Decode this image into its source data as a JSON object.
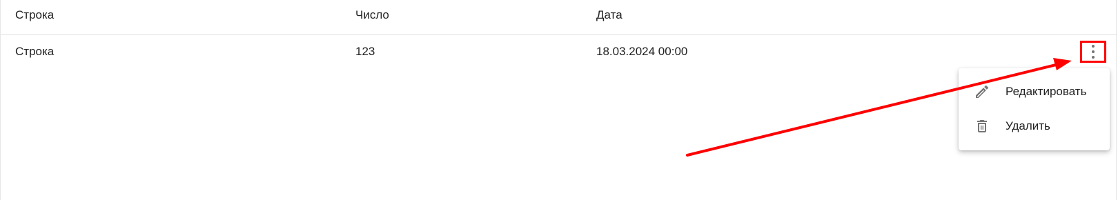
{
  "table": {
    "headers": {
      "string": "Строка",
      "number": "Число",
      "date": "Дата"
    },
    "rows": [
      {
        "string": "Строка",
        "number": "123",
        "date": "18.03.2024 00:00"
      }
    ]
  },
  "row_actions": {
    "icon": "more-vert-icon",
    "menu": {
      "items": [
        {
          "label": "Редактировать",
          "icon": "pencil-icon"
        },
        {
          "label": "Удалить",
          "icon": "trash-icon"
        }
      ]
    }
  },
  "annotation": {
    "highlight_color": "#ff0000"
  }
}
